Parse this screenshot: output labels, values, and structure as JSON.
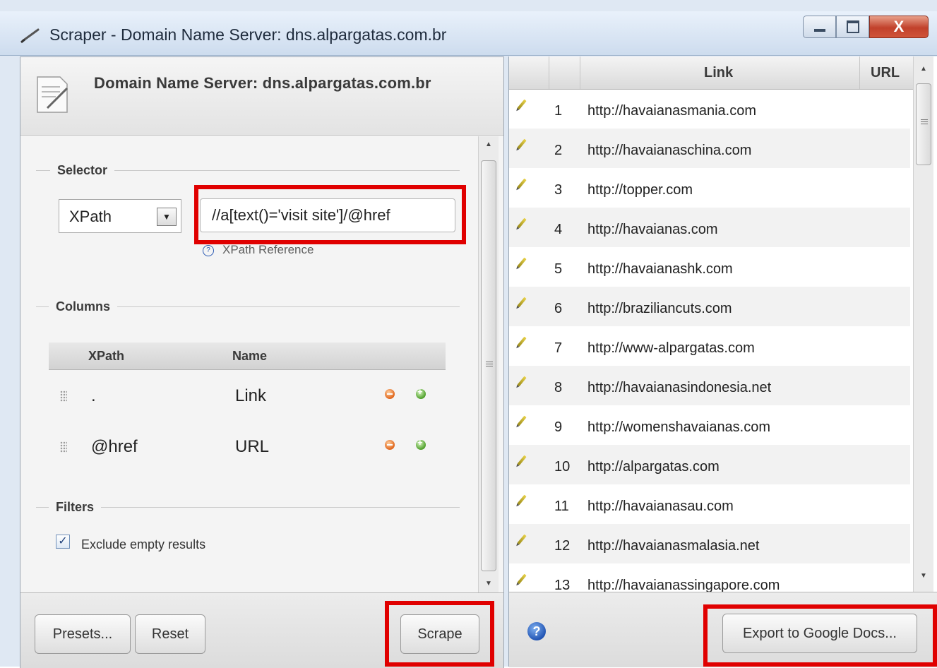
{
  "window": {
    "title": "Scraper - Domain Name Server: dns.alpargatas.com.br",
    "close_label": "X"
  },
  "left_panel": {
    "header_title": "Domain Name Server: dns.alpargatas.com.br",
    "selector": {
      "legend": "Selector",
      "type_value": "XPath",
      "expression": "//a[text()='visit site']/@href",
      "reference_link": "XPath Reference",
      "reference_icon": "?"
    },
    "columns": {
      "legend": "Columns",
      "headers": {
        "xpath": "XPath",
        "name": "Name"
      },
      "rows": [
        {
          "xpath": ".",
          "name": "Link"
        },
        {
          "xpath": "@href",
          "name": "URL"
        }
      ]
    },
    "filters": {
      "legend": "Filters",
      "exclude_empty_label": "Exclude empty results",
      "exclude_empty_checked": true,
      "check_mark": "✓"
    },
    "buttons": {
      "presets": "Presets...",
      "reset": "Reset",
      "scrape": "Scrape"
    }
  },
  "right_panel": {
    "headers": {
      "link": "Link",
      "url": "URL"
    },
    "rows": [
      {
        "num": "1",
        "link": "http://havaianasmania.com"
      },
      {
        "num": "2",
        "link": "http://havaianaschina.com"
      },
      {
        "num": "3",
        "link": "http://topper.com"
      },
      {
        "num": "4",
        "link": "http://havaianas.com"
      },
      {
        "num": "5",
        "link": "http://havaianashk.com"
      },
      {
        "num": "6",
        "link": "http://braziliancuts.com"
      },
      {
        "num": "7",
        "link": "http://www-alpargatas.com"
      },
      {
        "num": "8",
        "link": "http://havaianasindonesia.net"
      },
      {
        "num": "9",
        "link": "http://womenshavaianas.com"
      },
      {
        "num": "10",
        "link": "http://alpargatas.com"
      },
      {
        "num": "11",
        "link": "http://havaianasau.com"
      },
      {
        "num": "12",
        "link": "http://havaianasmalasia.net"
      },
      {
        "num": "13",
        "link": "http://havaianassingapore.com"
      }
    ],
    "help_icon": "?",
    "export_button": "Export to Google Docs..."
  },
  "colors": {
    "highlight": "#e00000",
    "title_bar": "#cddcee"
  },
  "icons": {
    "title": "scraper-brush-icon",
    "header": "document-edit-icon",
    "row": "pencil-icon"
  }
}
